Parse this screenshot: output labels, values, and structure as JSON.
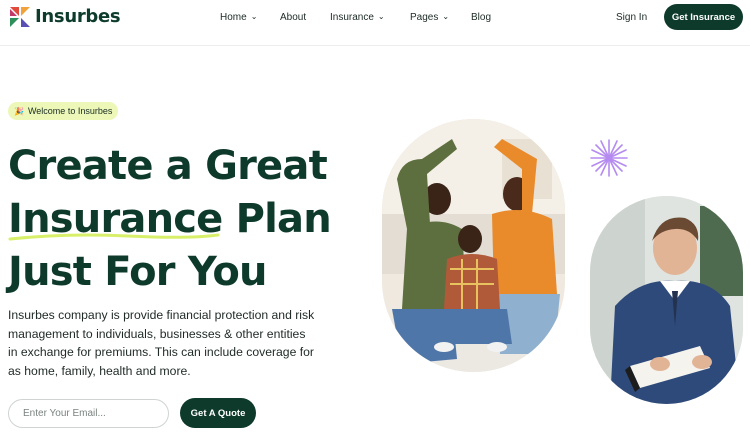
{
  "brand": {
    "name": "Insurbes"
  },
  "nav": {
    "items": [
      {
        "label": "Home",
        "has_dropdown": true
      },
      {
        "label": "About",
        "has_dropdown": false
      },
      {
        "label": "Insurance",
        "has_dropdown": true
      },
      {
        "label": "Pages",
        "has_dropdown": true
      },
      {
        "label": "Blog",
        "has_dropdown": false
      }
    ],
    "signin_label": "Sign In",
    "cta_label": "Get Insurance"
  },
  "hero": {
    "badge_icon": "party-popper-icon",
    "badge_text": "Welcome to Insurbes",
    "headline": {
      "line1": "Create a Great",
      "line2_highlight": "Insurance",
      "line2_rest": " Plan",
      "line3": "Just For You"
    },
    "description": "Insurbes company is provide financial protection and risk management to individuals, businesses & other entities in exchange for premiums. This can include coverage for as home, family, health and more.",
    "email_placeholder": "Enter Your Email...",
    "quote_button_label": "Get A Quote"
  },
  "colors": {
    "primary": "#0e3a2b",
    "badge_bg": "#edf7b8",
    "underline_accent": "#d8ef6a",
    "sparkle": "#b58bf0"
  }
}
